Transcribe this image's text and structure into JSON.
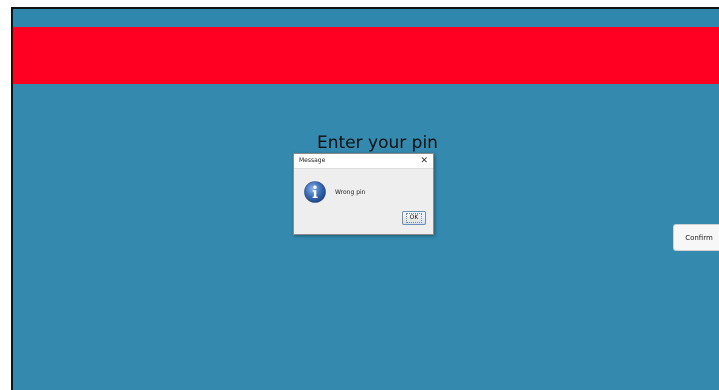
{
  "app": {
    "prompt_text": "Enter your pin",
    "confirm_label": "Confirm",
    "colors": {
      "background": "#3389ae",
      "banner": "#ff0022"
    }
  },
  "dialog": {
    "title": "Message",
    "close_glyph": "✕",
    "message": "Wrong pin",
    "ok_label": "OK",
    "icon": "info-icon"
  }
}
